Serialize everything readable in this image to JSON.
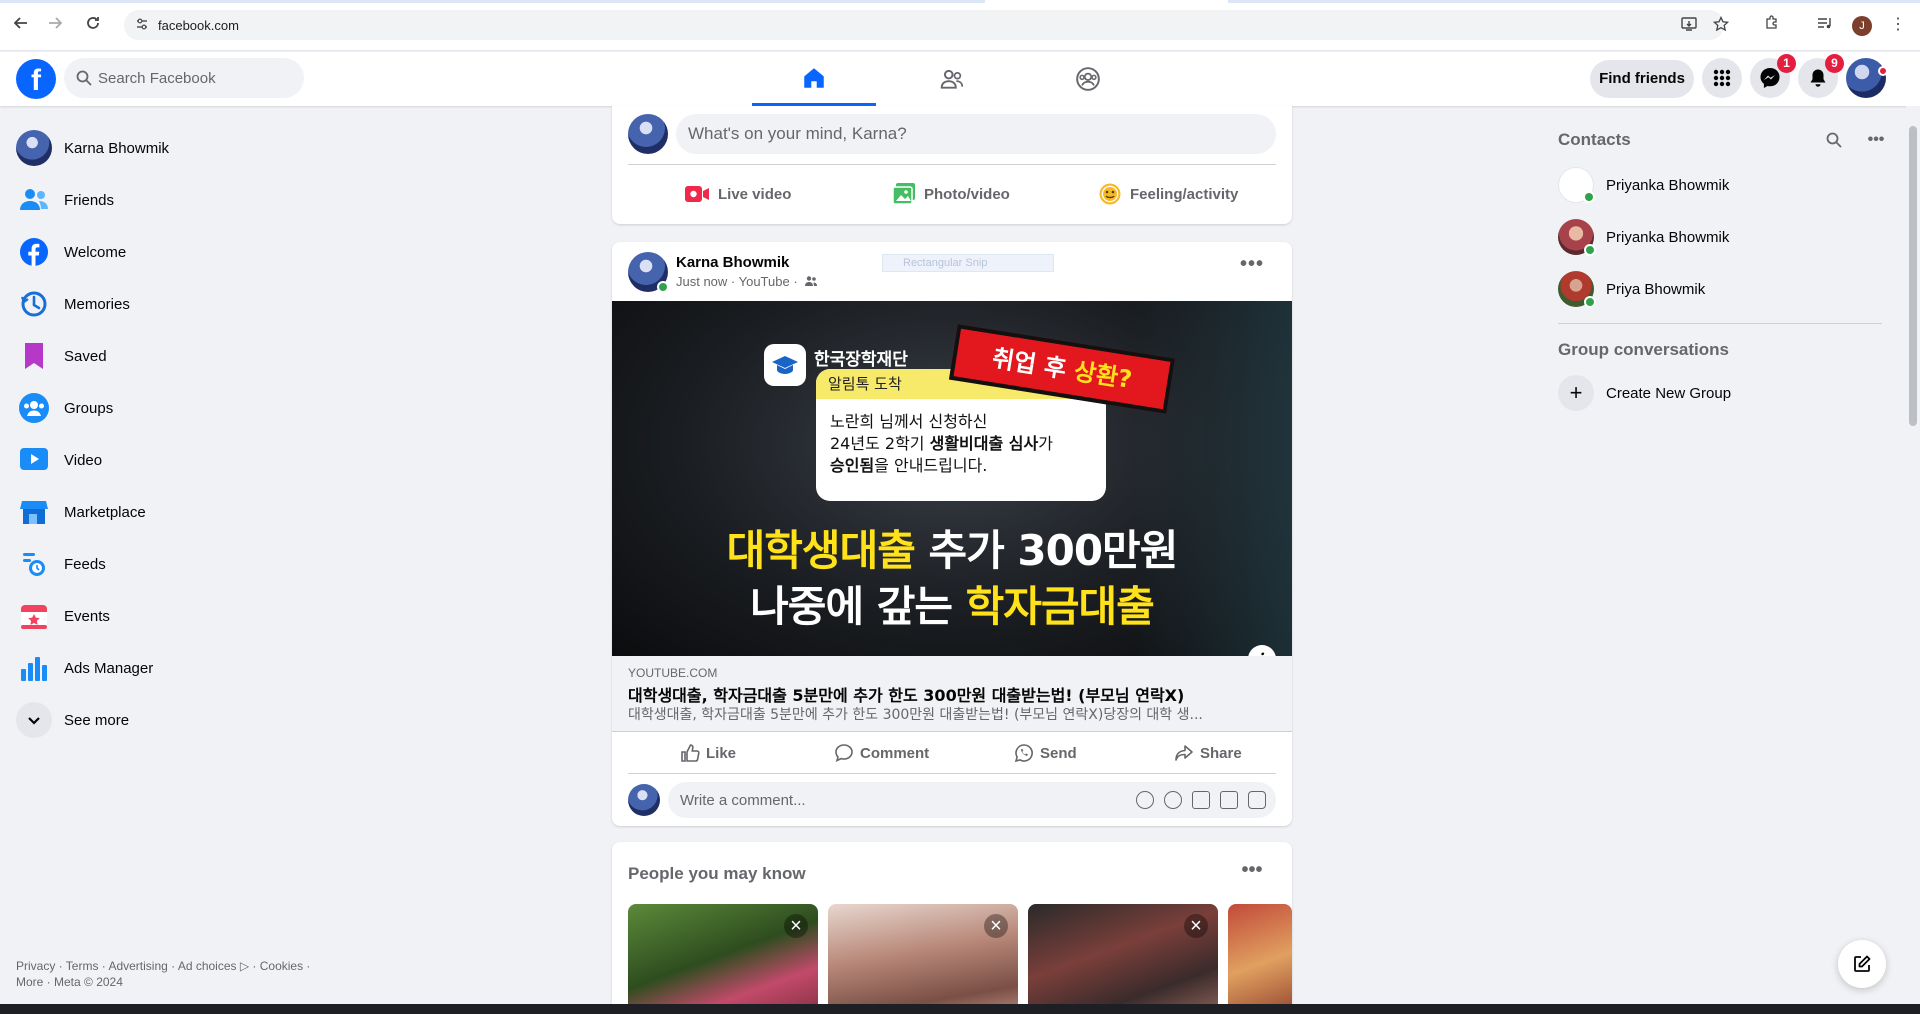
{
  "browser": {
    "url": "facebook.com",
    "back_icon": "arrow-left-icon",
    "forward_icon": "arrow-right-icon",
    "reload_icon": "reload-icon",
    "profile_initial": "J"
  },
  "header": {
    "search_placeholder": "Search Facebook",
    "find_friends_label": "Find friends",
    "messenger_badge": "1",
    "notifications_badge": "9",
    "tabs": [
      {
        "name": "home",
        "active": true
      },
      {
        "name": "friends",
        "active": false
      },
      {
        "name": "groups",
        "active": false
      }
    ]
  },
  "left_nav": {
    "items": [
      {
        "label": "Karna Bhowmik",
        "icon": "user-avatar"
      },
      {
        "label": "Friends",
        "icon": "friends-icon"
      },
      {
        "label": "Welcome",
        "icon": "facebook-icon"
      },
      {
        "label": "Memories",
        "icon": "clock-icon"
      },
      {
        "label": "Saved",
        "icon": "bookmark-icon"
      },
      {
        "label": "Groups",
        "icon": "groups-icon"
      },
      {
        "label": "Video",
        "icon": "video-icon"
      },
      {
        "label": "Marketplace",
        "icon": "shop-icon"
      },
      {
        "label": "Feeds",
        "icon": "feeds-icon"
      },
      {
        "label": "Events",
        "icon": "calendar-icon"
      },
      {
        "label": "Ads Manager",
        "icon": "bar-chart-icon"
      },
      {
        "label": "See more",
        "icon": "chevron-down-icon"
      }
    ],
    "footer_line1": "Privacy · Terms · Advertising · Ad choices ▷ · Cookies ·",
    "footer_line2": "More · Meta © 2024"
  },
  "composer": {
    "placeholder": "What's on your mind, Karna?",
    "actions": [
      "Live video",
      "Photo/video",
      "Feeling/activity"
    ]
  },
  "post": {
    "author": "Karna Bhowmik",
    "meta": "Just now · YouTube ·",
    "snip_overlay": "Rectangular Snip",
    "thumbnail": {
      "brand": "한국장학재단",
      "alert": "알림톡 도착",
      "message_line1": "노란희 님께서 신청하신",
      "message_line2a": "24년도 2학기 ",
      "message_line2b": "생활비대출 심사",
      "message_line2c": "가",
      "message_line3a": "승인됨",
      "message_line3b": "을 안내드립니다.",
      "tag_a": "취업 후 ",
      "tag_b": "상환?",
      "big1_a": "대학생대출",
      "big1_b": " 추가 300만원",
      "big2_a": "나중에 갚는 ",
      "big2_b": "학자금대출"
    },
    "link_domain": "YOUTUBE.COM",
    "link_title": "대학생대출, 학자금대출 5분만에 추가 한도 300만원 대출받는법! (부모님 연락X)",
    "link_desc": "대학생대출, 학자금대출 5분만에 추가 한도 300만원 대출받는법! (부모님 연락X)당장의 대학 생...",
    "actions": [
      "Like",
      "Comment",
      "Send",
      "Share"
    ],
    "comment_placeholder": "Write a comment..."
  },
  "pymk": {
    "title": "People you may know"
  },
  "contacts": {
    "title": "Contacts",
    "people": [
      {
        "name": "Priyanka Bhowmik"
      },
      {
        "name": "Priyanka Bhowmik"
      },
      {
        "name": "Priya Bhowmik"
      }
    ],
    "group_title": "Group conversations",
    "create_group_label": "Create New Group"
  },
  "colors": {
    "brand": "#0866ff",
    "badge": "#e41e3f",
    "online": "#31a24c",
    "thumbnail_yellow": "#ffe21a"
  }
}
